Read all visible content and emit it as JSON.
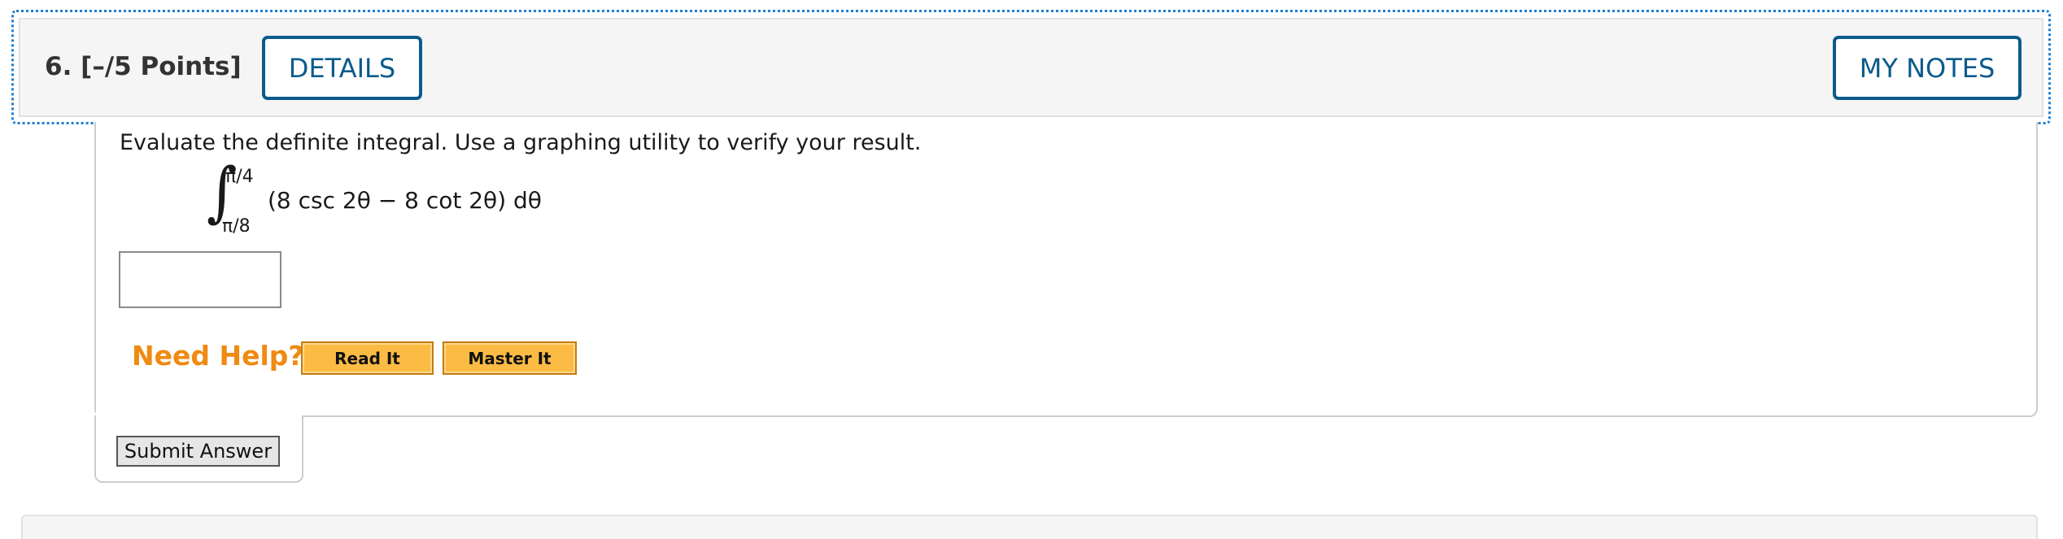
{
  "question": {
    "number_label": "6.",
    "points_label": "[–/5 Points]",
    "details_label": "DETAILS",
    "my_notes_label": "MY NOTES"
  },
  "prompt": "Evaluate the definite integral. Use a graphing utility to verify your result.",
  "integral": {
    "upper_limit": "π/4",
    "lower_limit": "π/8",
    "integrand": "(8 csc 2θ − 8 cot 2θ) dθ"
  },
  "answer": {
    "value": ""
  },
  "help": {
    "label": "Need Help?",
    "read_it": "Read It",
    "master_it": "Master It"
  },
  "submit_label": "Submit Answer",
  "colors": {
    "accent": "#0b5b8c",
    "focus": "#1f7fcf",
    "help_text": "#ef8a12",
    "help_button": "#fcbb44"
  }
}
